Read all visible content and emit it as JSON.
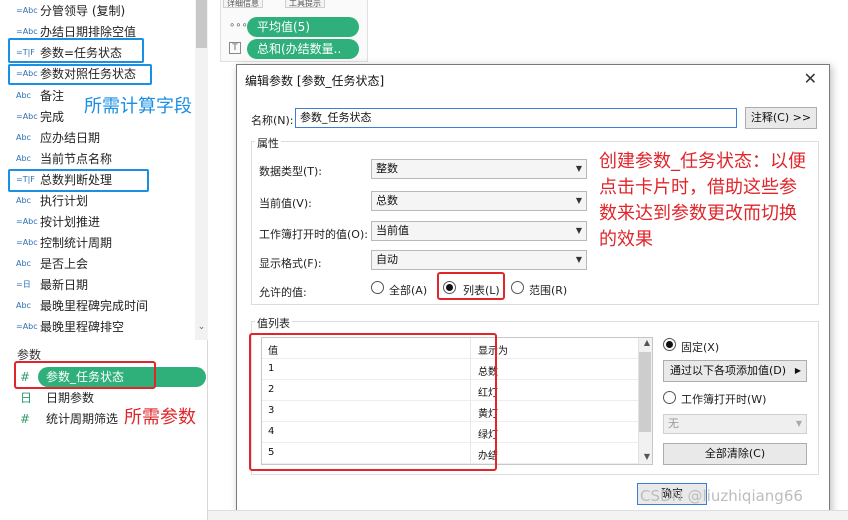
{
  "left_pane": {
    "fields": [
      {
        "type": "=Abc",
        "label": "分管领导 (复制)"
      },
      {
        "type": "=Abc",
        "label": "办结日期排除空值"
      },
      {
        "type": "=T|F",
        "label": "参数=任务状态"
      },
      {
        "type": "=Abc",
        "label": "参数对照任务状态"
      },
      {
        "type": "Abc",
        "label": "备注"
      },
      {
        "type": "=Abc",
        "label": "完成"
      },
      {
        "type": "Abc",
        "label": "应办结日期"
      },
      {
        "type": "Abc",
        "label": "当前节点名称"
      },
      {
        "type": "=T|F",
        "label": "总数判断处理"
      },
      {
        "type": "Abc",
        "label": "执行计划"
      },
      {
        "type": "=Abc",
        "label": "按计划推进"
      },
      {
        "type": "=Abc",
        "label": "控制统计周期"
      },
      {
        "type": "Abc",
        "label": "是否上会"
      },
      {
        "type": "=日",
        "label": "最新日期"
      },
      {
        "type": "Abc",
        "label": "最晚里程碑完成时间"
      },
      {
        "type": "=Abc",
        "label": "最晚里程碑排空"
      }
    ],
    "params_title": "参数",
    "params": [
      {
        "icon": "#",
        "label": "参数_任务状态"
      },
      {
        "icon": "日",
        "label": "日期参数"
      },
      {
        "icon": "#",
        "label": "统计周期筛选"
      }
    ],
    "note_calc": "所需计算字段",
    "note_param": "所需参数"
  },
  "marks": {
    "tab1": "详细信息",
    "tab2": "工具提示",
    "pill1": "平均值(5)",
    "pill2": "总和(办结数量..",
    "icon1": "∘∘∘",
    "icon2": "T"
  },
  "dialog": {
    "title": "编辑参数 [参数_任务状态]",
    "close": "✕",
    "name_label": "名称(N):",
    "name_value": "参数_任务状态",
    "comment_button": "注释(C) >>",
    "properties_title": "属性",
    "datatype_label": "数据类型(T):",
    "datatype_value": "整数",
    "current_label": "当前值(V):",
    "current_value": "总数",
    "onopen_label": "工作簿打开时的值(O):",
    "onopen_value": "当前值",
    "format_label": "显示格式(F):",
    "format_value": "自动",
    "allowed_label": "允许的值:",
    "allowed_all": "全部(A)",
    "allowed_list": "列表(L)",
    "allowed_range": "范围(R)",
    "annotation": [
      "创建参数_任务状态：以便",
      "点击卡片时，借助这些参",
      "数来达到参数更改而切换",
      "的效果"
    ],
    "values_title": "值列表",
    "table": {
      "headers": [
        "值",
        "显示为"
      ],
      "rows": [
        [
          "1",
          "总数"
        ],
        [
          "2",
          "红灯"
        ],
        [
          "3",
          "黄灯"
        ],
        [
          "4",
          "绿灯"
        ],
        [
          "5",
          "办结"
        ]
      ]
    },
    "fixed_label": "固定(X)",
    "add_from_button": "通过以下各项添加值(D)",
    "add_from_arrow": "▶",
    "onopen_radio_label": "工作簿打开时(W)",
    "none_value": "无",
    "clear_all_button": "全部清除(C)",
    "ok_button": "确定"
  },
  "watermark": "CSDN @liuzhiqiang66"
}
